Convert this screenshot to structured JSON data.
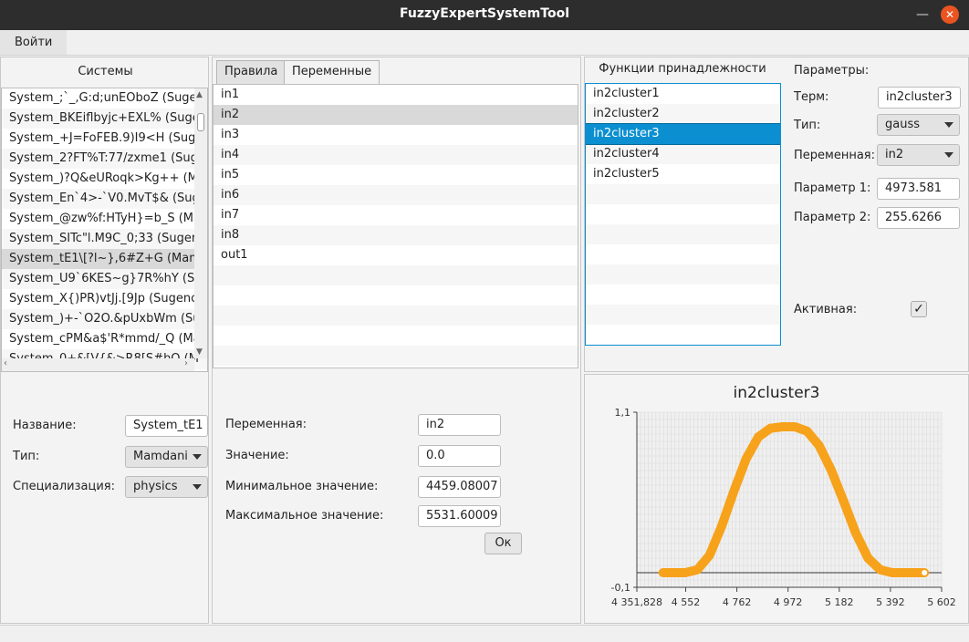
{
  "window": {
    "title": "FuzzyExpertSystemTool",
    "minimize_glyph": "—",
    "close_glyph": "✕"
  },
  "menu": {
    "login": "Войти"
  },
  "systems": {
    "header": "Системы",
    "items": [
      "System_;`_,G:d;unEOboZ (Suge",
      "System_BKEiflbyjc+EXL% (Suge",
      "System_+J=FoFEB.9)I9<H (Sug",
      "System_2?FT%T:77/zxme1 (Sug",
      "System_)?Q&eURoqk>Kg++ (M",
      "System_En`4>-`V0.MvT$& (Sug",
      "System_@zw%f:HTyH}=b_S (M",
      "System_SITc\"l.M9C_0;33 (Suger",
      "System_tE1\\[?l~},6#Z+G (Mam",
      "System_U9`6KES~g}7R%hY (S",
      "System_X{)PR)vtJj.[9Jp (Sugenc",
      "System_)+-`O2O.&pUxbWm (Su",
      "System_cPM&a$'R*mmd/_Q (Ma",
      "System_0+&[V{&>R8[S#hQ (M"
    ],
    "selected_index": 8,
    "name_label": "Название:",
    "name_value": "System_tE1",
    "type_label": "Тип:",
    "type_value": "Mamdani",
    "spec_label": "Специализация:",
    "spec_value": "physics"
  },
  "variables": {
    "tab_rules": "Правила",
    "tab_vars": "Переменные",
    "items": [
      "in1",
      "in2",
      "in3",
      "in4",
      "in5",
      "in6",
      "in7",
      "in8",
      "out1"
    ],
    "selected_index": 1,
    "var_label": "Переменная:",
    "var_value": "in2",
    "value_label": "Значение:",
    "value_value": "0.0",
    "min_label": "Минимальное значение:",
    "min_value": "4459.08007",
    "max_label": "Максимальное значение:",
    "max_value": "5531.60009",
    "ok_label": "Ок"
  },
  "membership": {
    "header": "Функции принадлежности",
    "items": [
      "in2cluster1",
      "in2cluster2",
      "in2cluster3",
      "in2cluster4",
      "in2cluster5"
    ],
    "selected_index": 2,
    "params_label": "Параметры:",
    "term_label": "Терм:",
    "term_value": "in2cluster3",
    "type_label": "Тип:",
    "type_value": "gauss",
    "variable_label": "Переменная:",
    "variable_value": "in2",
    "param1_label": "Параметр 1:",
    "param1_value": "4973.581",
    "param2_label": "Параметр 2:",
    "param2_value": "255.6266",
    "active_label": "Активная:",
    "active": true,
    "active_glyph": "✓"
  },
  "chart_data": {
    "type": "line",
    "title": "in2cluster3",
    "xlim": [
      4351.828,
      5602
    ],
    "ylim": [
      -0.1,
      1.1
    ],
    "x_ticks": [
      "4 351,828",
      "4 552",
      "4 762",
      "4 972",
      "5 182",
      "5 392",
      "5 602"
    ],
    "x_tick_values": [
      4351.828,
      4552,
      4762,
      4972,
      5182,
      5392,
      5602
    ],
    "y_ticks": [
      "1,1",
      "-0,1"
    ],
    "y_tick_values": [
      1.1,
      -0.1
    ],
    "series": [
      {
        "color": "#f7a21b",
        "function": "gauss",
        "mean": 4973.581,
        "sigma": 255.6266,
        "x": [
          4459.08,
          4500,
          4550,
          4600,
          4650,
          4700,
          4750,
          4800,
          4850,
          4900,
          4950,
          4973.581,
          5000,
          5050,
          5100,
          5150,
          5200,
          5250,
          5300,
          5350,
          5400,
          5450,
          5500,
          5531.6
        ],
        "values": [
          0,
          0,
          0,
          0.02,
          0.12,
          0.32,
          0.56,
          0.78,
          0.93,
          0.99,
          1.0,
          1.0,
          1.0,
          0.97,
          0.87,
          0.7,
          0.49,
          0.27,
          0.1,
          0.02,
          0,
          0,
          0,
          0
        ]
      }
    ],
    "baseline": 0,
    "grid": true
  }
}
